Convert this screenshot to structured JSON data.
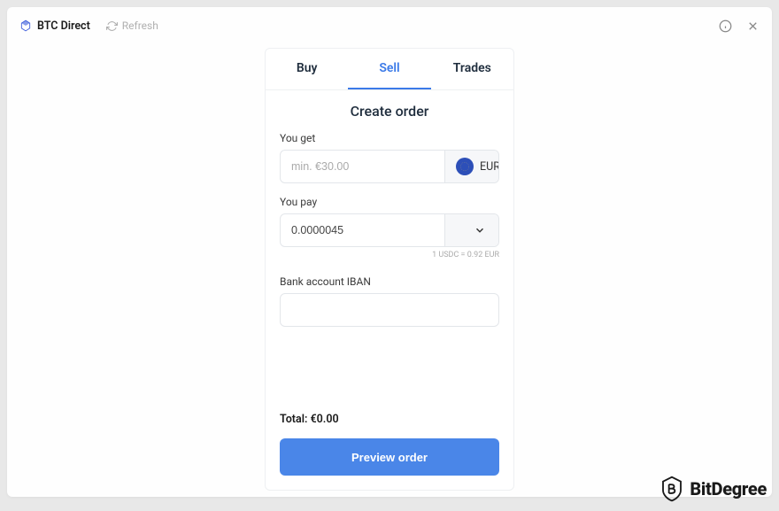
{
  "header": {
    "brand": "BTC Direct",
    "refresh_label": "Refresh"
  },
  "tabs": {
    "buy": "Buy",
    "sell": "Sell",
    "trades": "Trades",
    "active": "sell"
  },
  "form": {
    "title": "Create order",
    "you_get": {
      "label": "You get",
      "placeholder": "min. €30.00",
      "value": "",
      "currency": "EUR"
    },
    "you_pay": {
      "label": "You pay",
      "value": "0.0000045"
    },
    "rate": "1 USDC = 0.92 EUR",
    "iban": {
      "label": "Bank account IBAN",
      "value": ""
    },
    "total_label": "Total: €0.00",
    "preview_button": "Preview order"
  },
  "watermark": "BitDegree"
}
